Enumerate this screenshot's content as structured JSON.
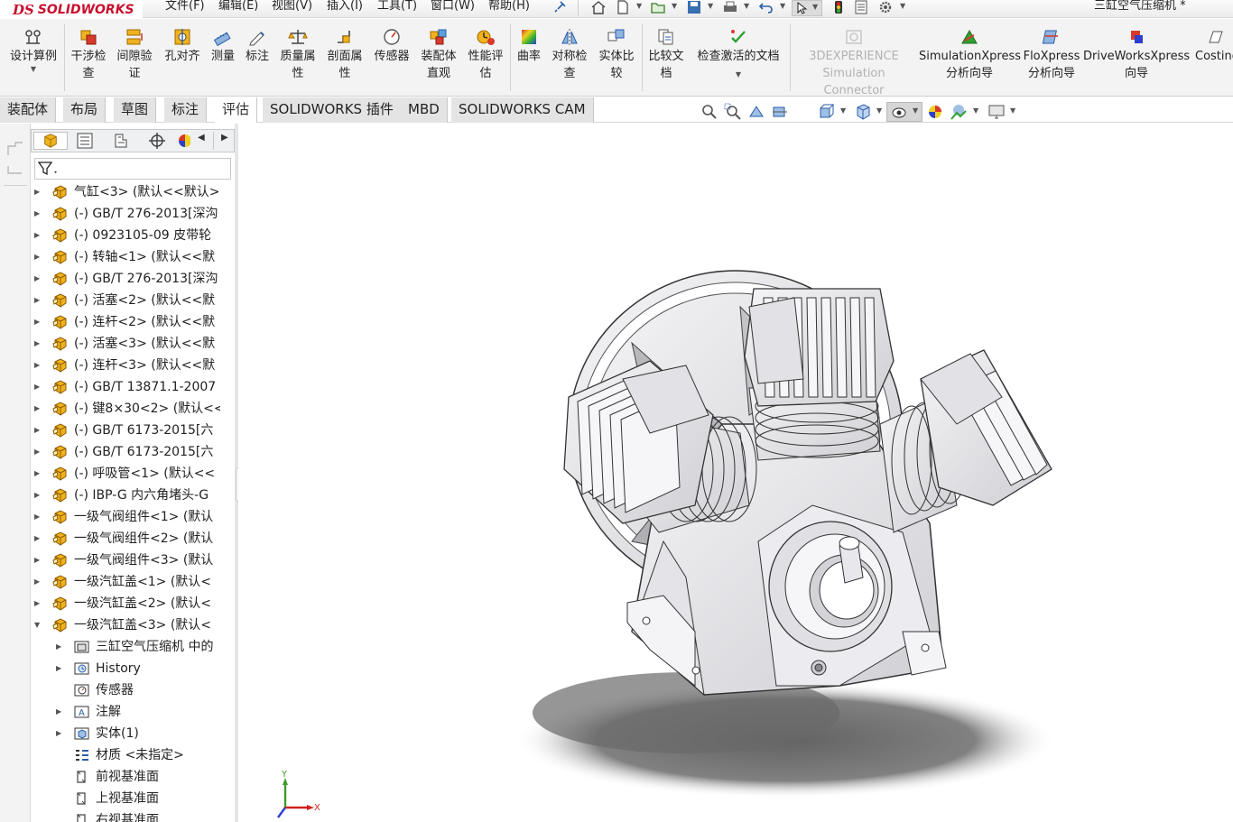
{
  "app": {
    "logo_ds": "DS",
    "logo_name": "SOLIDWORKS",
    "document_title": "三缸空气压缩机 *"
  },
  "menu": [
    "文件(F)",
    "编辑(E)",
    "视图(V)",
    "插入(I)",
    "工具(T)",
    "窗口(W)",
    "帮助(H)"
  ],
  "ribbon": {
    "design_study": "设计算例",
    "interference": "干涉检\n查",
    "clearance": "间隙验\n证",
    "hole_align": "孔对齐",
    "measure": "测量",
    "markup": "标注",
    "mass_props": "质量属\n性",
    "section_props": "剖面属\n性",
    "sensor": "传感器",
    "assembly_visual": "装配体\n直观",
    "perf_eval": "性能评\n估",
    "curvature": "曲率",
    "symmetry": "对称检\n查",
    "compare_bodies": "实体比\n较",
    "compare_docs": "比较文\n档",
    "check_active": "检查激活的文档",
    "threedx_line1": "3DEXPERIENCE",
    "threedx_line2": "Simulation Connector",
    "simxpress": "SimulationXpress\n分析向导",
    "floxpress": "FloXpress\n分析向导",
    "driveworks": "DriveWorksXpress\n向导",
    "costing": "Costing"
  },
  "tabs": [
    "装配体",
    "布局",
    "草图",
    "标注",
    "评估",
    "SOLIDWORKS 插件",
    "MBD",
    "SOLIDWORKS CAM"
  ],
  "active_tab": "评估",
  "tree": [
    {
      "label": "气缸<3> (默认<<默认>",
      "type": "part",
      "expander": "collapsed",
      "level": 0
    },
    {
      "label": "(-) GB/T 276-2013[深沟",
      "type": "part",
      "expander": "collapsed",
      "level": 0
    },
    {
      "label": "(-) 0923105-09 皮带轮",
      "type": "part",
      "expander": "collapsed",
      "level": 0
    },
    {
      "label": "(-) 转轴<1> (默认<<默",
      "type": "part",
      "expander": "collapsed",
      "level": 0
    },
    {
      "label": "(-) GB/T 276-2013[深沟",
      "type": "part",
      "expander": "collapsed",
      "level": 0
    },
    {
      "label": "(-) 活塞<2> (默认<<默",
      "type": "part",
      "expander": "collapsed",
      "level": 0
    },
    {
      "label": "(-) 连杆<2> (默认<<默",
      "type": "part",
      "expander": "collapsed",
      "level": 0
    },
    {
      "label": "(-) 活塞<3> (默认<<默",
      "type": "part",
      "expander": "collapsed",
      "level": 0
    },
    {
      "label": "(-) 连杆<3> (默认<<默",
      "type": "part",
      "expander": "collapsed",
      "level": 0
    },
    {
      "label": "(-) GB/T 13871.1-2007",
      "type": "part",
      "expander": "collapsed",
      "level": 0
    },
    {
      "label": "(-) 键8×30<2> (默认<<",
      "type": "part",
      "expander": "collapsed",
      "level": 0
    },
    {
      "label": "(-) GB/T 6173-2015[六",
      "type": "part",
      "expander": "collapsed",
      "level": 0
    },
    {
      "label": "(-) GB/T 6173-2015[六",
      "type": "part",
      "expander": "collapsed",
      "level": 0
    },
    {
      "label": "(-) 呼吸管<1> (默认<<",
      "type": "part",
      "expander": "collapsed",
      "level": 0
    },
    {
      "label": "(-) IBP-G 内六角堵头-G",
      "type": "part",
      "expander": "collapsed",
      "level": 0
    },
    {
      "label": "一级气阀组件<1> (默认",
      "type": "part",
      "expander": "collapsed",
      "level": 0
    },
    {
      "label": "一级气阀组件<2> (默认",
      "type": "part",
      "expander": "collapsed",
      "level": 0
    },
    {
      "label": "一级气阀组件<3> (默认",
      "type": "part",
      "expander": "collapsed",
      "level": 0
    },
    {
      "label": "一级汽缸盖<1> (默认<",
      "type": "part",
      "expander": "collapsed",
      "level": 0
    },
    {
      "label": "一级汽缸盖<2> (默认<",
      "type": "part",
      "expander": "collapsed",
      "level": 0
    },
    {
      "label": "一级汽缸盖<3> (默认<",
      "type": "part",
      "expander": "expanded",
      "level": 0
    },
    {
      "label": "三缸空气压缩机 中的",
      "type": "folder",
      "expander": "collapsed",
      "level": 1
    },
    {
      "label": "History",
      "type": "history",
      "expander": "collapsed",
      "level": 1
    },
    {
      "label": "传感器",
      "type": "sensor",
      "expander": "none",
      "level": 1
    },
    {
      "label": "注解",
      "type": "annotation",
      "expander": "collapsed",
      "level": 1
    },
    {
      "label": "实体(1)",
      "type": "solid",
      "expander": "collapsed",
      "level": 1
    },
    {
      "label": "材质 <未指定>",
      "type": "material",
      "expander": "none",
      "level": 1
    },
    {
      "label": "前视基准面",
      "type": "plane",
      "expander": "none",
      "level": 1
    },
    {
      "label": "上视基准面",
      "type": "plane",
      "expander": "none",
      "level": 1
    },
    {
      "label": "右视基准面",
      "type": "plane",
      "expander": "none",
      "level": 1
    }
  ],
  "triad": {
    "x": "X",
    "y": "Y"
  },
  "colors": {
    "brand": "#c8102e",
    "part_icon": "#f0b21d",
    "axis_x": "#d0231b",
    "axis_y": "#3d9a2a",
    "axis_z": "#2d3fd0"
  }
}
